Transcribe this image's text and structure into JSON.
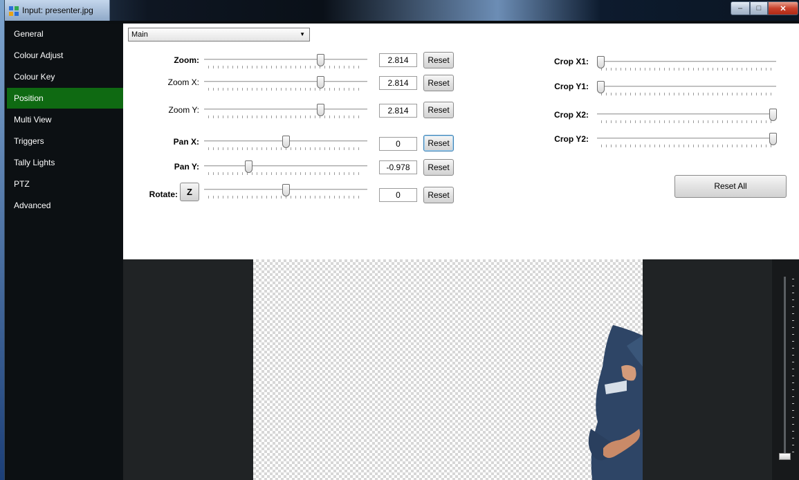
{
  "window": {
    "title": "Input: presenter.jpg",
    "controls": {
      "minimize": "‒",
      "maximize": "□",
      "close": "✕"
    }
  },
  "sidebar": {
    "items": [
      {
        "label": "General",
        "active": false
      },
      {
        "label": "Colour Adjust",
        "active": false
      },
      {
        "label": "Colour Key",
        "active": false
      },
      {
        "label": "Position",
        "active": true
      },
      {
        "label": "Multi View",
        "active": false
      },
      {
        "label": "Triggers",
        "active": false
      },
      {
        "label": "Tally Lights",
        "active": false
      },
      {
        "label": "PTZ",
        "active": false
      },
      {
        "label": "Advanced",
        "active": false
      }
    ]
  },
  "position": {
    "source_select": {
      "value": "Main"
    },
    "zoom": {
      "label": "Zoom:",
      "value": "2.814",
      "reset": "Reset",
      "slider_fraction": 0.72
    },
    "zoom_x": {
      "label": "Zoom X:",
      "value": "2.814",
      "reset": "Reset",
      "slider_fraction": 0.72
    },
    "zoom_y": {
      "label": "Zoom Y:",
      "value": "2.814",
      "reset": "Reset",
      "slider_fraction": 0.72
    },
    "pan_x": {
      "label": "Pan X:",
      "value": "0",
      "reset": "Reset",
      "slider_fraction": 0.5
    },
    "pan_y": {
      "label": "Pan Y:",
      "value": "-0.978",
      "reset": "Reset",
      "slider_fraction": 0.26
    },
    "rotate": {
      "label": "Rotate:",
      "z_button": "Z",
      "value": "0",
      "reset": "Reset",
      "slider_fraction": 0.5
    },
    "crop_x1": {
      "label": "Crop X1:",
      "slider_fraction": 0.0
    },
    "crop_y1": {
      "label": "Crop Y1:",
      "slider_fraction": 0.0
    },
    "crop_x2": {
      "label": "Crop X2:",
      "slider_fraction": 1.0
    },
    "crop_y2": {
      "label": "Crop Y2:",
      "slider_fraction": 1.0
    },
    "reset_all": "Reset All"
  },
  "preview": {
    "volume_fraction": 0.0
  },
  "colors": {
    "active_nav": "#0f6a12",
    "panel_bg": "#ffffff",
    "sidebar_bg": "#0c1013"
  }
}
